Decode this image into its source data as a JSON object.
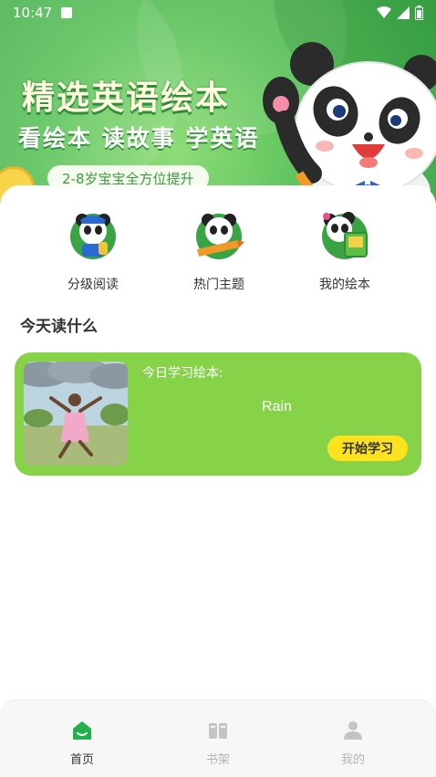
{
  "status_bar": {
    "time": "10:47",
    "icons": [
      "notification-icon",
      "wifi-icon",
      "signal-icon",
      "battery-icon"
    ]
  },
  "banner": {
    "title": "精选英语绘本",
    "subtitle": "看绘本 读故事 学英语",
    "pill": "2-8岁宝宝全方位提升"
  },
  "categories": [
    {
      "label": "分级阅读",
      "icon": "panda-backpack-icon"
    },
    {
      "label": "热门主题",
      "icon": "panda-pencil-icon"
    },
    {
      "label": "我的绘本",
      "icon": "panda-book-icon"
    }
  ],
  "section": {
    "title": "今天读什么"
  },
  "lesson": {
    "label": "今日学习绘本:",
    "name": "Rain",
    "button": "开始学习"
  },
  "nav": [
    {
      "label": "首页",
      "icon": "home-icon",
      "active": true
    },
    {
      "label": "书架",
      "icon": "bookshelf-icon",
      "active": false
    },
    {
      "label": "我的",
      "icon": "profile-icon",
      "active": false
    }
  ],
  "colors": {
    "brand_green": "#5dc25c",
    "card_green": "#86d34a",
    "button_yellow": "#ffe21e",
    "nav_active": "#22b14c",
    "nav_inactive": "#b4b4b4"
  }
}
